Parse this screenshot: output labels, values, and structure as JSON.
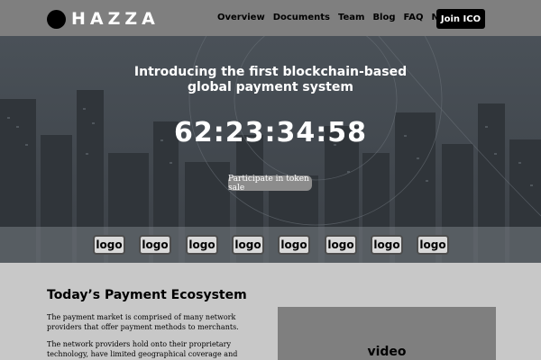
{
  "header": {
    "brand": "HAZZA",
    "nav": [
      "Overview",
      "Documents",
      "Team",
      "Blog",
      "FAQ",
      "News"
    ],
    "join_label": "Join ICO"
  },
  "hero": {
    "title_line1": "Introducing the first blockchain-based",
    "title_line2": "global payment system",
    "countdown": "62:23:34:58",
    "cta_label": "Participate in token sale"
  },
  "partners": [
    "logo",
    "logo",
    "logo",
    "logo",
    "logo",
    "logo",
    "logo",
    "logo"
  ],
  "ecosystem": {
    "title": "Today’s Payment Ecosystem",
    "paragraph1": "The payment market is comprised of many network providers that offer payment methods to merchants.",
    "paragraph2": "The network providers hold onto their proprietary technology, have limited geographical coverage and accept only a few payment methods.",
    "video_label": "video"
  },
  "colors": {
    "header_bg": "#7f7f7f",
    "hero_bg": "#454b51",
    "page_bg": "#c8c8c8",
    "join_bg": "#000000"
  }
}
